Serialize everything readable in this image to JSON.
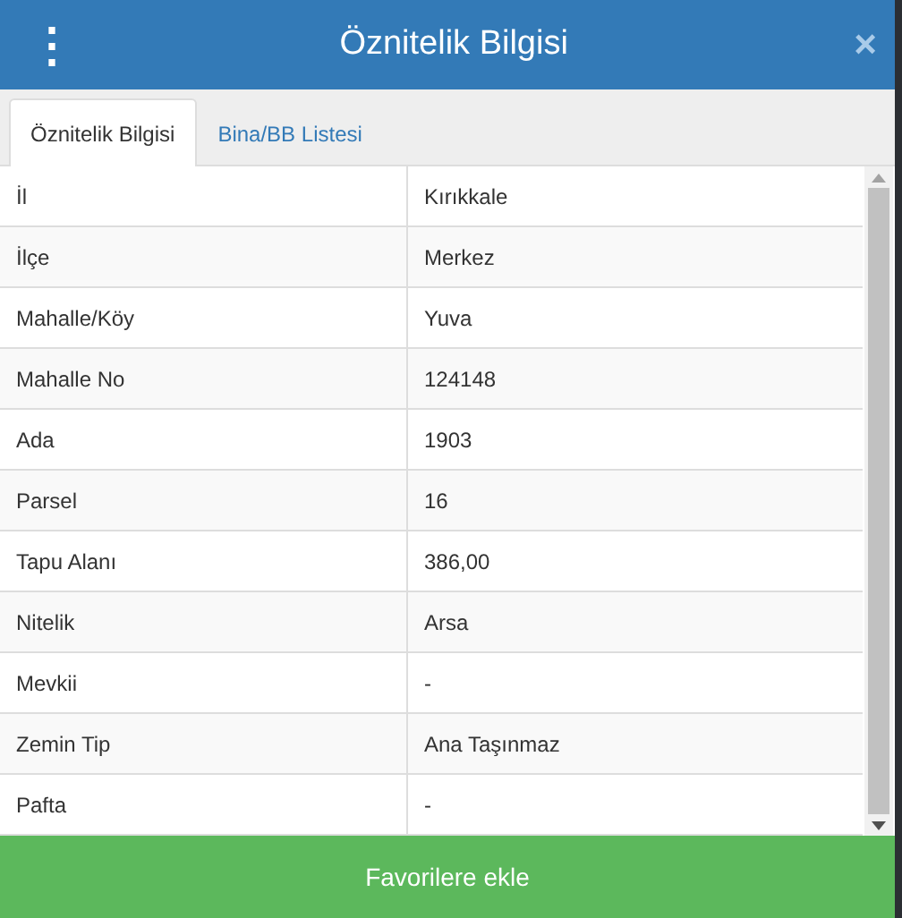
{
  "window": {
    "title": "Öznitelik Bilgisi",
    "menu_icon": "⋮",
    "close_icon": "×"
  },
  "tabs": [
    {
      "label": "Öznitelik Bilgisi",
      "selected": true
    },
    {
      "label": "Bina/BB Listesi",
      "selected": false
    }
  ],
  "table": {
    "rows": [
      {
        "name": "İl",
        "value": "Kırıkkale"
      },
      {
        "name": "İlçe",
        "value": "Merkez"
      },
      {
        "name": "Mahalle/Köy",
        "value": "Yuva"
      },
      {
        "name": "Mahalle No",
        "value": "124148"
      },
      {
        "name": "Ada",
        "value": "1903"
      },
      {
        "name": "Parsel",
        "value": "16"
      },
      {
        "name": "Tapu Alanı",
        "value": "386,00"
      },
      {
        "name": "Nitelik",
        "value": "Arsa"
      },
      {
        "name": "Mevkii",
        "value": "-"
      },
      {
        "name": "Zemin Tip",
        "value": "Ana Taşınmaz"
      },
      {
        "name": "Pafta",
        "value": "-"
      }
    ]
  },
  "button": {
    "label": "Favorilere ekle"
  }
}
